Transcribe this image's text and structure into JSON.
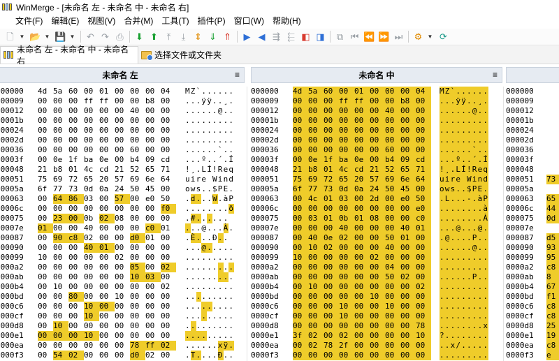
{
  "window": {
    "title": "WinMerge - [未命名 左 - 未命名 中 - 未命名 右]"
  },
  "menu": [
    "文件(F)",
    "编辑(E)",
    "视图(V)",
    "合并(M)",
    "工具(T)",
    "插件(P)",
    "窗口(W)",
    "帮助(H)"
  ],
  "toolbar": {
    "groups": [
      [
        "new-icon",
        "dropdown-arrow",
        "open-icon",
        "dropdown-arrow",
        "save-icon",
        "dropdown-arrow"
      ],
      [
        "undo-icon",
        "redo-icon",
        "print-icon"
      ],
      [
        "next-diff-icon",
        "prev-diff-icon",
        "first-diff-icon",
        "last-diff-icon",
        "current-diff-icon",
        "next-conflict-icon",
        "prev-conflict-icon"
      ],
      [
        "copy-right-icon",
        "copy-left-icon",
        "copy-all-right-icon",
        "copy-all-left-icon",
        "merge-icon",
        "merge-all-icon"
      ],
      [
        "split-icon",
        "first-file-icon",
        "prev-file-icon",
        "next-file-icon",
        "last-file-icon"
      ],
      [
        "options-icon",
        "dropdown-arrow",
        "refresh-icon"
      ]
    ]
  },
  "tabs": [
    {
      "label": "未命名 左 - 未命名 中 - 未命名 右",
      "active": true
    },
    {
      "label": "选择文件或文件夹",
      "active": false
    }
  ],
  "panes": [
    {
      "title": "未命名 左"
    },
    {
      "title": "未命名 中"
    },
    {
      "title": ""
    }
  ],
  "addresses": [
    "000000",
    "000009",
    "000012",
    "00001b",
    "000024",
    "00002d",
    "000036",
    "00003f",
    "000048",
    "000051",
    "00005a",
    "000063",
    "00006c",
    "000075",
    "00007e",
    "000087",
    "000090",
    "000099",
    "0000a2",
    "0000ab",
    "0000b4",
    "0000bd",
    "0000c6",
    "0000cf",
    "0000d8",
    "0000e1",
    "0000ea",
    "0000f3"
  ],
  "left_rows": [
    {
      "bytes": [
        "4d",
        "5a",
        "60",
        "00",
        "01",
        "00",
        "00",
        "00",
        "04"
      ],
      "hb": [],
      "ascii": "MZ`......",
      "ha": []
    },
    {
      "bytes": [
        "00",
        "00",
        "00",
        "ff",
        "ff",
        "00",
        "00",
        "b8",
        "00"
      ],
      "hb": [],
      "ascii": "...ÿÿ..¸.",
      "ha": []
    },
    {
      "bytes": [
        "00",
        "00",
        "00",
        "00",
        "00",
        "00",
        "40",
        "00",
        "00"
      ],
      "hb": [],
      "ascii": "......@..",
      "ha": []
    },
    {
      "bytes": [
        "00",
        "00",
        "00",
        "00",
        "00",
        "00",
        "00",
        "00",
        "00"
      ],
      "hb": [],
      "ascii": ".........",
      "ha": []
    },
    {
      "bytes": [
        "00",
        "00",
        "00",
        "00",
        "00",
        "00",
        "00",
        "00",
        "00"
      ],
      "hb": [],
      "ascii": ".........",
      "ha": []
    },
    {
      "bytes": [
        "00",
        "00",
        "00",
        "00",
        "00",
        "00",
        "00",
        "00",
        "00"
      ],
      "hb": [],
      "ascii": ".........",
      "ha": []
    },
    {
      "bytes": [
        "00",
        "00",
        "00",
        "00",
        "00",
        "00",
        "60",
        "00",
        "00"
      ],
      "hb": [],
      "ascii": "......`..",
      "ha": []
    },
    {
      "bytes": [
        "00",
        "0e",
        "1f",
        "ba",
        "0e",
        "00",
        "b4",
        "09",
        "cd"
      ],
      "hb": [],
      "ascii": "...º..´.Í",
      "ha": []
    },
    {
      "bytes": [
        "21",
        "b8",
        "01",
        "4c",
        "cd",
        "21",
        "52",
        "65",
        "71"
      ],
      "hb": [],
      "ascii": "!¸.LÍ!Req",
      "ha": []
    },
    {
      "bytes": [
        "75",
        "69",
        "72",
        "65",
        "20",
        "57",
        "69",
        "6e",
        "64"
      ],
      "hb": [],
      "ascii": "uire Wind",
      "ha": []
    },
    {
      "bytes": [
        "6f",
        "77",
        "73",
        "0d",
        "0a",
        "24",
        "50",
        "45",
        "00"
      ],
      "hb": [],
      "ascii": "ows..$PE.",
      "ha": []
    },
    {
      "bytes": [
        "00",
        "64",
        "86",
        "03",
        "00",
        "57",
        "00",
        "e0",
        "50"
      ],
      "hb": [
        1,
        2,
        5
      ],
      "ascii": ".d...W.àP",
      "ha": [
        1,
        2,
        5
      ]
    },
    {
      "bytes": [
        "00",
        "00",
        "00",
        "00",
        "00",
        "00",
        "00",
        "00",
        "f0"
      ],
      "hb": [
        8
      ],
      "ascii": "........ð",
      "ha": [
        8
      ]
    },
    {
      "bytes": [
        "00",
        "23",
        "00",
        "0b",
        "02",
        "08",
        "00",
        "00",
        "00"
      ],
      "hb": [
        1,
        2,
        4
      ],
      "ascii": ".#......",
      "ha": [
        1,
        2,
        4
      ]
    },
    {
      "bytes": [
        "01",
        "00",
        "00",
        "40",
        "00",
        "00",
        "00",
        "c0",
        "01"
      ],
      "hb": [
        0,
        7
      ],
      "ascii": "...@...À.",
      "ha": [
        0,
        7
      ]
    },
    {
      "bytes": [
        "00",
        "90",
        "c8",
        "02",
        "00",
        "00",
        "d0",
        "01",
        "00"
      ],
      "hb": [
        1,
        2,
        6
      ],
      "ascii": ".È...Ð..",
      "ha": [
        1,
        2,
        6
      ]
    },
    {
      "bytes": [
        "00",
        "00",
        "00",
        "40",
        "01",
        "00",
        "00",
        "00",
        "00"
      ],
      "hb": [
        3,
        4
      ],
      "ascii": "...@.....",
      "ha": [
        3,
        4
      ]
    },
    {
      "bytes": [
        "10",
        "00",
        "00",
        "00",
        "00",
        "02",
        "00",
        "00",
        "00"
      ],
      "hb": [],
      "ascii": ".........",
      "ha": []
    },
    {
      "bytes": [
        "00",
        "00",
        "00",
        "00",
        "00",
        "00",
        "05",
        "00",
        "02"
      ],
      "hb": [
        6,
        8
      ],
      "ascii": ".........",
      "ha": [
        6,
        8
      ]
    },
    {
      "bytes": [
        "00",
        "00",
        "00",
        "00",
        "00",
        "00",
        "10",
        "03",
        "00"
      ],
      "hb": [
        6,
        7
      ],
      "ascii": ".........",
      "ha": [
        6,
        7
      ]
    },
    {
      "bytes": [
        "00",
        "10",
        "00",
        "00",
        "00",
        "00",
        "00",
        "00",
        "02"
      ],
      "hb": [],
      "ascii": ".........",
      "ha": []
    },
    {
      "bytes": [
        "00",
        "00",
        "80",
        "00",
        "00",
        "10",
        "00",
        "00",
        "00"
      ],
      "hb": [
        2
      ],
      "ascii": ".........",
      "ha": [
        2
      ]
    },
    {
      "bytes": [
        "00",
        "00",
        "00",
        "10",
        "00",
        "00",
        "00",
        "00",
        "00"
      ],
      "hb": [
        3,
        4
      ],
      "ascii": ".........",
      "ha": [
        3,
        4
      ]
    },
    {
      "bytes": [
        "00",
        "00",
        "00",
        "10",
        "00",
        "00",
        "00",
        "00",
        "00"
      ],
      "hb": [
        3
      ],
      "ascii": ".........",
      "ha": [
        3
      ]
    },
    {
      "bytes": [
        "00",
        "10",
        "00",
        "00",
        "00",
        "00",
        "00",
        "00",
        "00"
      ],
      "hb": [
        1
      ],
      "ascii": ".........",
      "ha": [
        1
      ]
    },
    {
      "bytes": [
        "00",
        "00",
        "00",
        "10",
        "00",
        "00",
        "00",
        "00",
        "00"
      ],
      "hb": [
        0,
        1,
        2,
        3
      ],
      "ascii": ".........",
      "ha": [
        0,
        1,
        2,
        3
      ]
    },
    {
      "bytes": [
        "00",
        "00",
        "00",
        "00",
        "00",
        "00",
        "78",
        "ff",
        "02"
      ],
      "hb": [
        6,
        7,
        8
      ],
      "ascii": "......xÿ.",
      "ha": [
        6,
        7,
        8
      ]
    },
    {
      "bytes": [
        "00",
        "54",
        "02",
        "00",
        "00",
        "00",
        "d0",
        "02",
        "00"
      ],
      "hb": [
        1,
        2,
        6
      ],
      "ascii": ".T....Ð..",
      "ha": [
        1,
        2,
        6
      ]
    }
  ],
  "mid_rows": [
    {
      "bytes": [
        "4d",
        "5a",
        "60",
        "00",
        "01",
        "00",
        "00",
        "00",
        "04"
      ],
      "ascii": "MZ`......"
    },
    {
      "bytes": [
        "00",
        "00",
        "00",
        "ff",
        "ff",
        "00",
        "00",
        "b8",
        "00"
      ],
      "ascii": "...ÿÿ..¸."
    },
    {
      "bytes": [
        "00",
        "00",
        "00",
        "00",
        "00",
        "00",
        "40",
        "00",
        "00"
      ],
      "ascii": "......@.."
    },
    {
      "bytes": [
        "00",
        "00",
        "00",
        "00",
        "00",
        "00",
        "00",
        "00",
        "00"
      ],
      "ascii": "........."
    },
    {
      "bytes": [
        "00",
        "00",
        "00",
        "00",
        "00",
        "00",
        "00",
        "00",
        "00"
      ],
      "ascii": "........."
    },
    {
      "bytes": [
        "00",
        "00",
        "00",
        "00",
        "00",
        "00",
        "00",
        "00",
        "00"
      ],
      "ascii": "........."
    },
    {
      "bytes": [
        "00",
        "00",
        "00",
        "00",
        "00",
        "00",
        "60",
        "00",
        "00"
      ],
      "ascii": "......`.."
    },
    {
      "bytes": [
        "00",
        "0e",
        "1f",
        "ba",
        "0e",
        "00",
        "b4",
        "09",
        "cd"
      ],
      "ascii": "...º..´.Í"
    },
    {
      "bytes": [
        "21",
        "b8",
        "01",
        "4c",
        "cd",
        "21",
        "52",
        "65",
        "71"
      ],
      "ascii": "!¸.LÍ!Req"
    },
    {
      "bytes": [
        "75",
        "69",
        "72",
        "65",
        "20",
        "57",
        "69",
        "6e",
        "64"
      ],
      "ascii": "uire Wind"
    },
    {
      "bytes": [
        "6f",
        "77",
        "73",
        "0d",
        "0a",
        "24",
        "50",
        "45",
        "00"
      ],
      "ascii": "ows..$PE."
    },
    {
      "bytes": [
        "00",
        "4c",
        "01",
        "03",
        "00",
        "2d",
        "00",
        "e0",
        "50"
      ],
      "ascii": ".L...-.àP"
    },
    {
      "bytes": [
        "00",
        "00",
        "00",
        "00",
        "00",
        "00",
        "00",
        "00",
        "e0"
      ],
      "ascii": "........à"
    },
    {
      "bytes": [
        "00",
        "03",
        "01",
        "0b",
        "01",
        "08",
        "00",
        "00",
        "c0"
      ],
      "ascii": "........À"
    },
    {
      "bytes": [
        "00",
        "00",
        "00",
        "40",
        "00",
        "00",
        "00",
        "40",
        "01"
      ],
      "ascii": "...@...@."
    },
    {
      "bytes": [
        "00",
        "40",
        "0e",
        "02",
        "00",
        "00",
        "50",
        "01",
        "00"
      ],
      "ascii": ".@....P.."
    },
    {
      "bytes": [
        "00",
        "10",
        "02",
        "00",
        "00",
        "00",
        "40",
        "00",
        "00"
      ],
      "ascii": "......@.."
    },
    {
      "bytes": [
        "10",
        "00",
        "00",
        "00",
        "00",
        "02",
        "00",
        "00",
        "00"
      ],
      "ascii": "........."
    },
    {
      "bytes": [
        "00",
        "00",
        "00",
        "00",
        "00",
        "00",
        "04",
        "00",
        "00"
      ],
      "ascii": "........."
    },
    {
      "bytes": [
        "00",
        "00",
        "00",
        "00",
        "00",
        "00",
        "50",
        "02",
        "00"
      ],
      "ascii": "......P.."
    },
    {
      "bytes": [
        "00",
        "10",
        "00",
        "00",
        "00",
        "00",
        "00",
        "00",
        "02"
      ],
      "ascii": "........."
    },
    {
      "bytes": [
        "00",
        "00",
        "00",
        "00",
        "00",
        "10",
        "00",
        "00",
        "00"
      ],
      "ascii": "........."
    },
    {
      "bytes": [
        "00",
        "00",
        "00",
        "10",
        "00",
        "00",
        "10",
        "00",
        "00"
      ],
      "ascii": "........."
    },
    {
      "bytes": [
        "00",
        "00",
        "00",
        "10",
        "00",
        "00",
        "00",
        "00",
        "00"
      ],
      "ascii": "........."
    },
    {
      "bytes": [
        "00",
        "00",
        "00",
        "00",
        "00",
        "00",
        "00",
        "00",
        "78"
      ],
      "ascii": "........x"
    },
    {
      "bytes": [
        "3f",
        "02",
        "00",
        "02",
        "00",
        "00",
        "00",
        "00",
        "10"
      ],
      "ascii": "?........"
    },
    {
      "bytes": [
        "00",
        "02",
        "78",
        "2f",
        "00",
        "00",
        "00",
        "00",
        "00"
      ],
      "ascii": "..x/....."
    },
    {
      "bytes": [
        "00",
        "00",
        "00",
        "00",
        "00",
        "00",
        "00",
        "00",
        "00"
      ],
      "ascii": "........."
    }
  ],
  "right_rows": [
    {
      "first": "",
      "hl": false
    },
    {
      "first": "",
      "hl": false
    },
    {
      "first": "",
      "hl": false
    },
    {
      "first": "",
      "hl": false
    },
    {
      "first": "",
      "hl": false
    },
    {
      "first": "",
      "hl": false
    },
    {
      "first": "",
      "hl": false
    },
    {
      "first": "",
      "hl": false
    },
    {
      "first": "",
      "hl": false
    },
    {
      "first": "73",
      "hl": true
    },
    {
      "first": "",
      "hl": false
    },
    {
      "first": "65",
      "hl": true
    },
    {
      "first": "44",
      "hl": true
    },
    {
      "first": "0d",
      "hl": true
    },
    {
      "first": "",
      "hl": false
    },
    {
      "first": "d5",
      "hl": true
    },
    {
      "first": "93",
      "hl": true
    },
    {
      "first": "95",
      "hl": true
    },
    {
      "first": "c8",
      "hl": true
    },
    {
      "first": "8",
      "hl": true
    },
    {
      "first": "67",
      "hl": true
    },
    {
      "first": "f1",
      "hl": true
    },
    {
      "first": "c8",
      "hl": true
    },
    {
      "first": "c8",
      "hl": true
    },
    {
      "first": "25",
      "hl": true
    },
    {
      "first": "19",
      "hl": true
    },
    {
      "first": "c8",
      "hl": true
    },
    {
      "first": "e",
      "hl": true
    }
  ],
  "colors": {
    "diff_highlight": "#efcc2a",
    "header_bg": "#e6ebf2"
  }
}
